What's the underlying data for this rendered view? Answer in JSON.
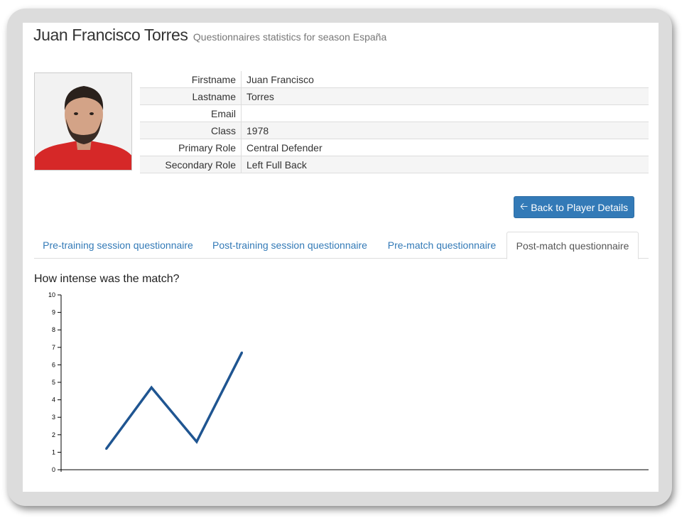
{
  "header": {
    "player_name": "Juan Francisco Torres",
    "subtitle": "Questionnaires statistics for season España"
  },
  "player": {
    "fields": [
      {
        "label": "Firstname",
        "value": "Juan Francisco"
      },
      {
        "label": "Lastname",
        "value": "Torres"
      },
      {
        "label": "Email",
        "value": ""
      },
      {
        "label": "Class",
        "value": "1978"
      },
      {
        "label": "Primary Role",
        "value": "Central Defender"
      },
      {
        "label": "Secondary Role",
        "value": "Left Full Back"
      }
    ]
  },
  "actions": {
    "back_label": "Back to Player Details",
    "back_icon": "arrow-left-icon"
  },
  "tabs": [
    {
      "label": "Pre-training session questionnaire",
      "active": false
    },
    {
      "label": "Post-training session questionnaire",
      "active": false
    },
    {
      "label": "Pre-match questionnaire",
      "active": false
    },
    {
      "label": "Post-match questionnaire",
      "active": true
    }
  ],
  "question": {
    "title": "How intense was the match?"
  },
  "colors": {
    "link": "#337ab7",
    "button": "#337ab7",
    "line": "#1f5591",
    "jersey": "#d62828"
  },
  "chart_data": {
    "type": "line",
    "title": "How intense was the match?",
    "xlabel": "",
    "ylabel": "",
    "ylim": [
      0,
      10
    ],
    "yticks": [
      0,
      1,
      2,
      3,
      4,
      5,
      6,
      7,
      8,
      9,
      10
    ],
    "grid": false,
    "legend": "none",
    "series": [
      {
        "x": [
          1,
          2,
          3,
          4
        ],
        "values": [
          1.2,
          4.7,
          1.6,
          6.7
        ]
      }
    ],
    "xlim": [
      0,
      13
    ]
  }
}
